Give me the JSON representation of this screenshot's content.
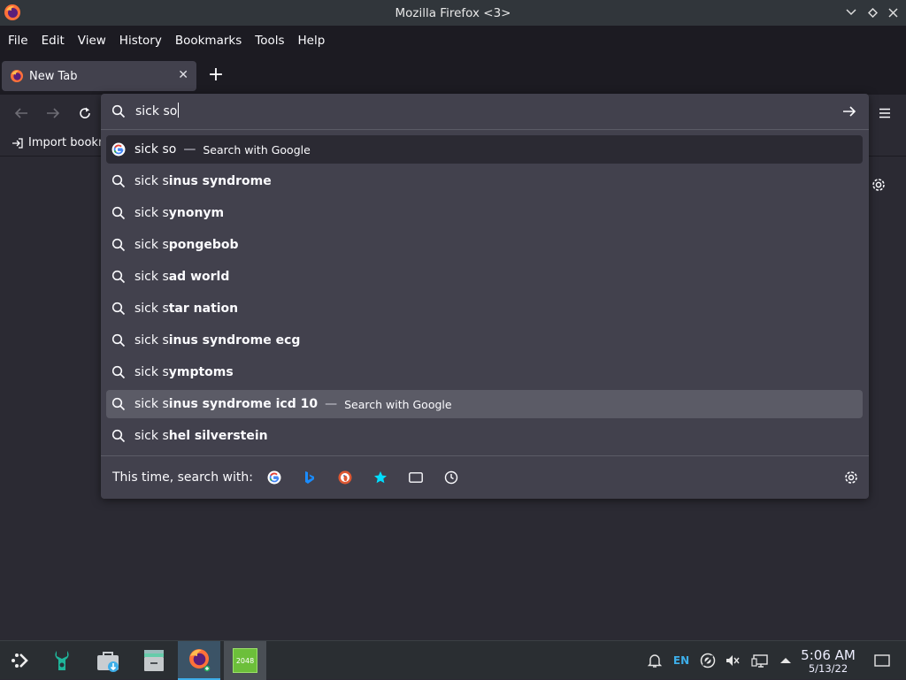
{
  "window": {
    "title": "Mozilla Firefox <3>"
  },
  "menubar": {
    "items": [
      {
        "label": "File"
      },
      {
        "label": "Edit"
      },
      {
        "label": "View"
      },
      {
        "label": "History"
      },
      {
        "label": "Bookmarks"
      },
      {
        "label": "Tools"
      },
      {
        "label": "Help"
      }
    ]
  },
  "tabs": [
    {
      "label": "New Tab",
      "icon": "firefox-icon",
      "active": true
    }
  ],
  "bookmarks": {
    "import_label": "Import bookm"
  },
  "urlbar": {
    "value": "sick so"
  },
  "suggestions": [
    {
      "typed": "sick s",
      "rest": "o",
      "action": "Search with Google",
      "icon": "google-icon",
      "row_state": "first"
    },
    {
      "typed": "sick s",
      "rest": "inus syndrome",
      "icon": "search-icon"
    },
    {
      "typed": "sick s",
      "rest": "ynonym",
      "icon": "search-icon"
    },
    {
      "typed": "sick s",
      "rest": "pongebob",
      "icon": "search-icon"
    },
    {
      "typed": "sick s",
      "rest": "ad world",
      "icon": "search-icon"
    },
    {
      "typed": "sick s",
      "rest": "tar nation",
      "icon": "search-icon"
    },
    {
      "typed": "sick s",
      "rest": "inus syndrome ecg",
      "icon": "search-icon"
    },
    {
      "typed": "sick s",
      "rest": "ymptoms",
      "icon": "search-icon"
    },
    {
      "typed": "sick s",
      "rest": "inus syndrome icd 10",
      "action": "Search with Google",
      "icon": "search-icon",
      "row_state": "hovered"
    },
    {
      "typed": "sick s",
      "rest": "hel silverstein",
      "icon": "search-icon"
    }
  ],
  "oneoff": {
    "label": "This time, search with:",
    "engines": [
      "google-icon",
      "bing-icon",
      "duckduckgo-icon",
      "bookmarks-star-icon",
      "tabs-icon",
      "history-clock-icon"
    ]
  },
  "taskbar": {
    "tray_language": "EN",
    "time": "5:06 AM",
    "date": "5/13/22",
    "app_2048_label": "2048"
  },
  "colors": {
    "accent": "#3daee9",
    "bing": "#1a8cff",
    "star": "#00ddff"
  }
}
